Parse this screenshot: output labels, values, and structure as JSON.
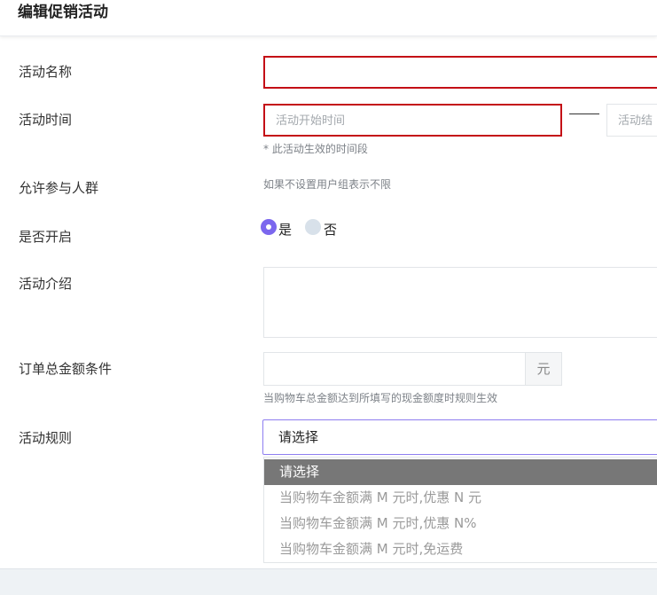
{
  "header": {
    "title": "编辑促销活动"
  },
  "form": {
    "name": {
      "label": "活动名称",
      "value": ""
    },
    "time": {
      "label": "活动时间",
      "start_placeholder": "活动开始时间",
      "end_placeholder": "活动结束时间",
      "end_visible_text": "活动结",
      "hint": "* 此活动生效的时间段"
    },
    "groups": {
      "label": "允许参与人群",
      "hint": "如果不设置用户组表示不限"
    },
    "enabled": {
      "label": "是否开启",
      "options": [
        {
          "label": "是",
          "checked": true
        },
        {
          "label": "否",
          "checked": false
        }
      ]
    },
    "intro": {
      "label": "活动介绍",
      "value": ""
    },
    "amount": {
      "label": "订单总金额条件",
      "value": "",
      "unit": "元",
      "hint": "当购物车总金额达到所填写的现金额度时规则生效"
    },
    "rule": {
      "label": "活动规则",
      "selected": "请选择",
      "options": [
        "请选择",
        "当购物车金额满 M 元时,优惠 N 元",
        "当购物车金额满 M 元时,优惠 N%",
        "当购物车金额满 M 元时,免运费"
      ]
    }
  },
  "colors": {
    "error_border": "#c40f16",
    "accent": "#7b67ee",
    "selected_option_bg": "#777777"
  }
}
